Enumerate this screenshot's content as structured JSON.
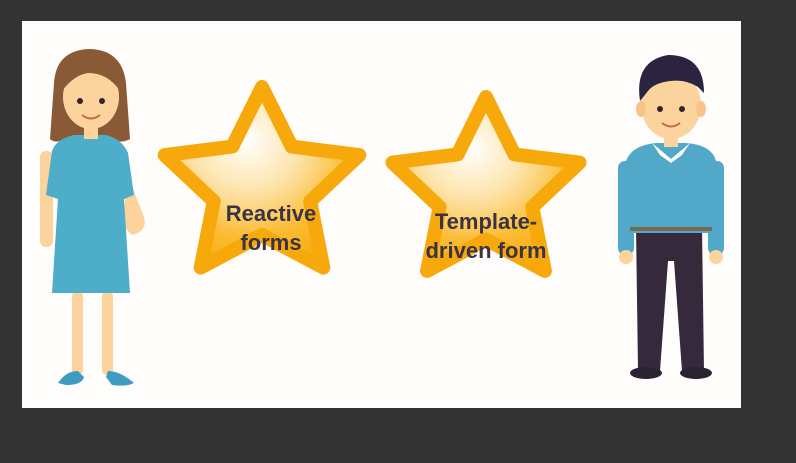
{
  "stars": [
    {
      "lines": [
        "Reactive",
        "forms"
      ]
    },
    {
      "lines": [
        "Template-",
        "driven form"
      ]
    }
  ],
  "colors": {
    "background": "#333333",
    "panel": "#fefdfc",
    "star_fill": "#fbb11a",
    "star_edge": "#f6a60c",
    "text": "#3a3344",
    "woman_dress": "#4eadc8",
    "man_sweater": "#52a8c9",
    "man_trousers": "#352a3b",
    "skin": "#fcd39c",
    "hair_woman": "#8a5a36",
    "hair_man": "#2b2440"
  },
  "icons": [
    "woman-figure-icon",
    "star-icon",
    "star-icon",
    "man-figure-icon"
  ]
}
